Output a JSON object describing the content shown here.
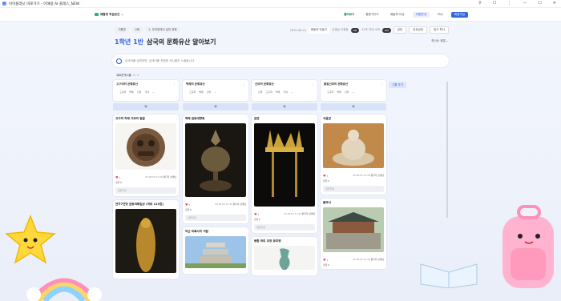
{
  "window": {
    "tab_title": "아이플래닛 바로가기 - 아해랑 AI 플래스_NEW",
    "controls": [
      "⚲",
      "☐",
      "⋮",
      "—",
      "☐",
      "✕"
    ]
  },
  "header": {
    "site_name": "패들렛 학급공간",
    "nav": [
      "둘러보기",
      "활용가이드",
      "패들렛 요금",
      "이용안내",
      "FAQ",
      "회원가입"
    ]
  },
  "breadcrumb": [
    "그룹명",
    "사회",
    "1. 우리땅에서 살던 문화"
  ],
  "controls": {
    "room_label": "2025.06.23",
    "room_val": "패들렛 만들기",
    "mode_label": "선생님 고정됨",
    "mode_val": "ON",
    "sound_label": "10초 이내 소리",
    "sound_val": "ON",
    "btn1": "설정",
    "btn2": "공유설정",
    "btn3": "링크 복사"
  },
  "title": {
    "grade": "1학년 1반",
    "text": "삼국의 문화유산 알아보기"
  },
  "sort_label": "최신순 정렬 ⌄",
  "search": {
    "placeholder": "검색어를 입력하면, 검색어를 포함한 게시물만 노출됩니다."
  },
  "feed": {
    "label": "새로운게시물",
    "count": "0 / 4"
  },
  "group_add": "그룹 추가",
  "columns": [
    {
      "name": "고구려의 문화유산",
      "tags": [
        "고구려",
        "백제",
        "신라",
        "가야"
      ],
      "cards": [
        {
          "title": "고구려 치레 기와의 얼굴",
          "likes": "3",
          "date": "25.06.03 11:39",
          "author": "돌다리 선생님",
          "comment": "댓글 0",
          "input": "댓글 달기"
        },
        {
          "title": "연가7년명 금동여래입상 (국보 119호)",
          "likes": "",
          "date": "",
          "author": "",
          "comment": "",
          "input": ""
        }
      ]
    },
    {
      "name": "백제의 문화유산",
      "tags": [
        "고구려",
        "백제",
        "신라"
      ],
      "cards": [
        {
          "title": "백제 금동대향로",
          "likes": "3",
          "date": "25.06.03 11:39",
          "author": "돌다리 선생님",
          "comment": "댓글 0",
          "input": "댓글 달기"
        },
        {
          "title": "익산 미륵사지 석탑",
          "likes": "",
          "date": "",
          "author": "",
          "comment": "",
          "input": ""
        }
      ]
    },
    {
      "name": "신라의 문화유산",
      "tags": [
        "신라",
        "고구려",
        "백제",
        "가야"
      ],
      "cards": [
        {
          "title": "금관",
          "likes": "3",
          "date": "25.06.03 11:39",
          "author": "돌다리 선생님",
          "comment": "댓글 0",
          "input": "댓글 달기"
        },
        {
          "title": "봉황 머리 모양 유리병",
          "likes": "",
          "date": "",
          "author": "",
          "comment": "",
          "input": ""
        }
      ]
    },
    {
      "name": "통일신라의 문화유산",
      "tags": [
        "고구려",
        "백제",
        "신라"
      ],
      "cards": [
        {
          "title": "석굴암",
          "likes": "3",
          "date": "25.06.03 11:39",
          "author": "돌다리 선생님",
          "comment": "댓글 0",
          "input": "댓글 달기"
        },
        {
          "title": "불국사",
          "likes": "3",
          "date": "25.06.03 11:39",
          "author": "돌다리 선생님",
          "comment": "댓글 0",
          "input": ""
        }
      ]
    }
  ]
}
